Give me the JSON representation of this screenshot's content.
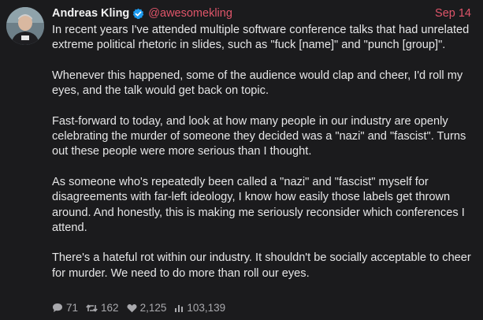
{
  "post": {
    "author": {
      "display_name": "Andreas Kling",
      "handle": "@awesomekling",
      "verified": true,
      "verified_icon": "verified-badge-icon"
    },
    "date": "Sep 14",
    "paragraphs": [
      "In recent years I've attended multiple software conference talks that had unrelated extreme political rhetoric in slides, such as \"fuck [name]\" and \"punch [group]\".",
      "Whenever this happened, some of the audience would clap and cheer, I'd roll my eyes, and the talk would get back on topic.",
      "Fast-forward to today, and look at how many people in our industry are openly celebrating the murder of someone they decided was a \"nazi\" and \"fascist\". Turns out these people were more serious than I thought.",
      "As someone who's repeatedly been called a \"nazi\" and \"fascist\" myself for disagreements with far-left ideology, I know how easily those labels get thrown around. And honestly, this is making me seriously reconsider which conferences I attend.",
      "There's a hateful rot within our industry. It shouldn't be socially acceptable to cheer for murder. We need to do more than roll our eyes."
    ],
    "stats": {
      "replies": "71",
      "reposts": "162",
      "likes": "2,125",
      "views": "103,139"
    }
  },
  "colors": {
    "background": "#1b1b1d",
    "accent": "#e0556a",
    "text": "#e6e6e7",
    "muted": "#a9a9ad",
    "verified": "#1d9bf0"
  }
}
